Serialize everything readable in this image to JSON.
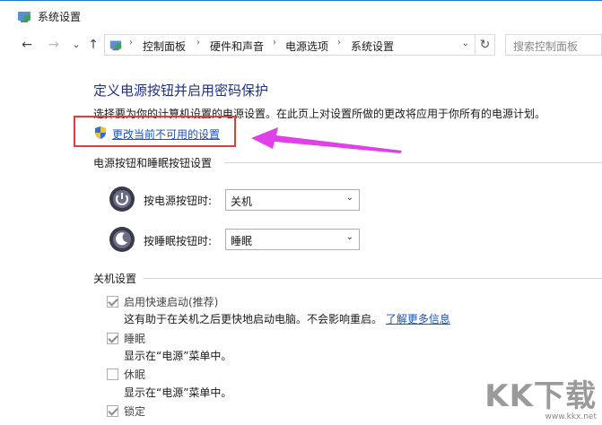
{
  "window": {
    "title": "系统设置"
  },
  "nav": {
    "back": "←",
    "forward": "→",
    "recent": "⌄",
    "up": "↑",
    "breadcrumbs": [
      "控制面板",
      "硬件和声音",
      "电源选项",
      "系统设置"
    ],
    "separator": "›",
    "dropdown": "⌄",
    "refresh": "↻",
    "search_placeholder": "搜索控制面板"
  },
  "main": {
    "heading": "定义电源按钮并启用密码保护",
    "description": "选择要为你的计算机设置的电源设置。在此页上对设置所做的更改将应用于你所有的电源计划。",
    "change_link": "更改当前不可用的设置"
  },
  "power_section": {
    "title": "电源按钮和睡眠按钮设置",
    "rows": [
      {
        "label": "按电源按钮时:",
        "value": "关机",
        "icon": "power-icon"
      },
      {
        "label": "按睡眠按钮时:",
        "value": "睡眠",
        "icon": "sleep-icon"
      }
    ]
  },
  "shutdown_section": {
    "title": "关机设置",
    "options": [
      {
        "label": "启用快速启动(推荐)",
        "checked": true,
        "desc": "这有助于在关机之后更快地启动电脑。不会影响重启。",
        "link": "了解更多信息"
      },
      {
        "label": "睡眠",
        "checked": true,
        "desc": "显示在“电源”菜单中。"
      },
      {
        "label": "休眠",
        "checked": false,
        "desc": "显示在“电源”菜单中。"
      },
      {
        "label": "锁定",
        "checked": true
      }
    ]
  },
  "watermark": {
    "logo": "KK下载",
    "url": "www.kkx.net"
  },
  "colors": {
    "heading": "#1e3287",
    "link": "#1a52c4",
    "highlight_box": "#e03c3c",
    "arrow": "#e040e8"
  }
}
